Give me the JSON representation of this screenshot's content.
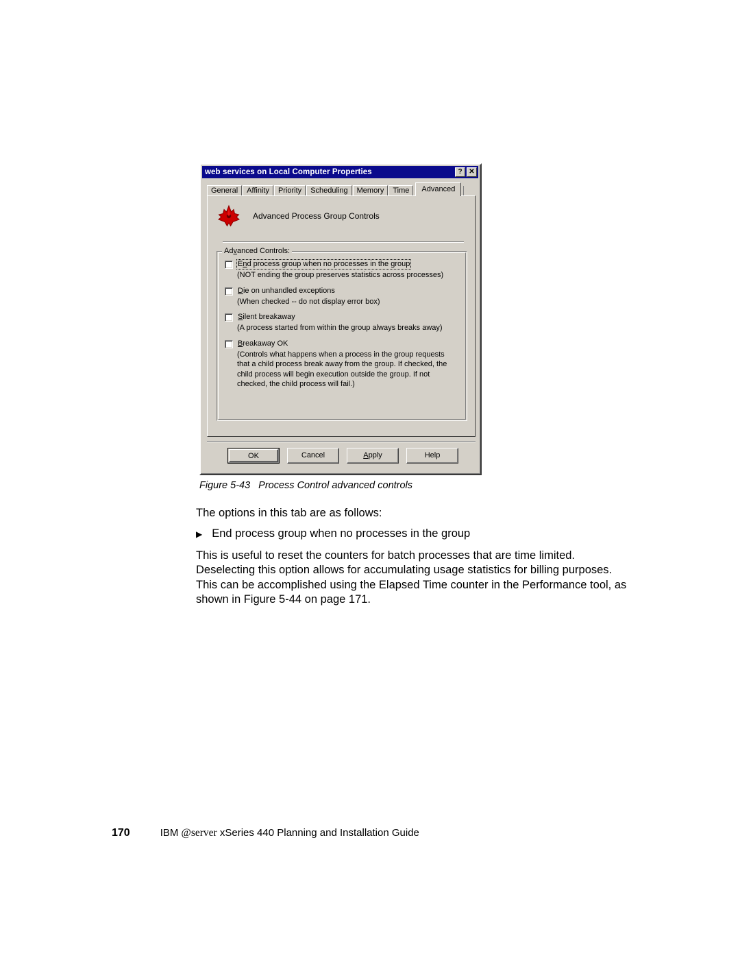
{
  "dialog": {
    "title": "web services on Local Computer Properties",
    "titlebar_buttons": [
      {
        "name": "help-button",
        "glyph": "?"
      },
      {
        "name": "close-button",
        "glyph": "✕"
      }
    ],
    "tabs": [
      {
        "label": "General",
        "active": false
      },
      {
        "label": "Affinity",
        "active": false
      },
      {
        "label": "Priority",
        "active": false
      },
      {
        "label": "Scheduling",
        "active": false
      },
      {
        "label": "Memory",
        "active": false
      },
      {
        "label": "Time",
        "active": false
      },
      {
        "label": "Advanced",
        "active": true
      }
    ],
    "page_header": {
      "icon": "red-four-point-star-icon",
      "label": "Advanced Process Group Controls"
    },
    "groupbox": {
      "title_pre": "Ad",
      "title_accel": "v",
      "title_post": "anced Controls:",
      "options": [
        {
          "label_pre": "E",
          "label_accel": "n",
          "label_post": "d process group when no processes in the group",
          "checked": false,
          "focused": true,
          "description": "(NOT ending the group preserves statistics across processes)"
        },
        {
          "label_pre": "",
          "label_accel": "D",
          "label_post": "ie on unhandled exceptions",
          "checked": false,
          "focused": false,
          "description": "(When checked -- do not display error box)"
        },
        {
          "label_pre": "",
          "label_accel": "S",
          "label_post": "ilent breakaway",
          "checked": false,
          "focused": false,
          "description": "(A process started from within the group always breaks away)"
        },
        {
          "label_pre": "",
          "label_accel": "B",
          "label_post": "reakaway OK",
          "checked": false,
          "focused": false,
          "description": "(Controls what happens when a process in the group requests that a child process break away from the group.  If checked, the child process will begin execution outside the group.  If not checked, the child process will fail.)"
        }
      ]
    },
    "buttons": [
      {
        "label": "OK",
        "default": true
      },
      {
        "label": "Cancel",
        "default": false
      },
      {
        "label": "Apply",
        "default": false,
        "accel": "A"
      },
      {
        "label": "Help",
        "default": false
      }
    ]
  },
  "page": {
    "figure_caption": {
      "number": "Figure 5-43",
      "text": "Process Control advanced controls"
    },
    "intro": "The options in this tab are as follows:",
    "bullet": {
      "mark": "▶",
      "text": "End process group when no processes in the group"
    },
    "paragraph": "This is useful to reset the counters for batch processes that are time limited. Deselecting this option allows for accumulating usage statistics for billing purposes. This can be accomplished using the Elapsed Time counter in the Performance tool, as shown in Figure 5-44 on page 171.",
    "footer": {
      "page_number": "170",
      "title_pre": "IBM ",
      "title_logo": "@server",
      "title_post": " xSeries 440 Planning and Installation Guide"
    }
  },
  "colors": {
    "titlebar": "#0a0a8c",
    "dialog_face": "#d4d0c8",
    "icon_red": "#cc0000",
    "page_bg": "#ffffff"
  }
}
